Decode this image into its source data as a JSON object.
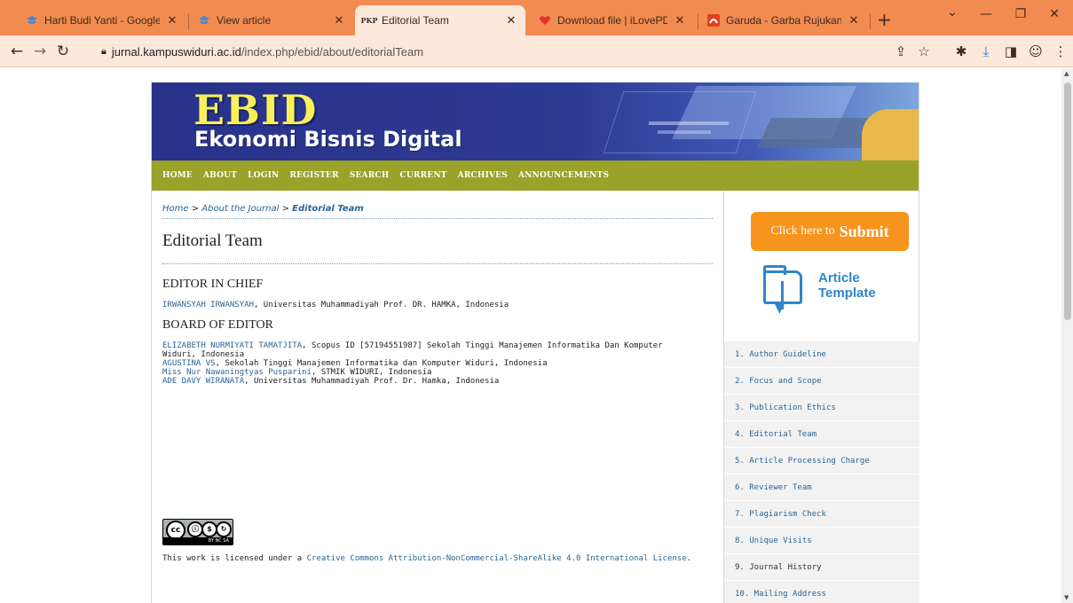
{
  "browser": {
    "tabs": [
      {
        "title": "Harti Budi Yanti - Google Sc",
        "favicon": "graduation-cap-icon"
      },
      {
        "title": "View article",
        "favicon": "graduation-cap-icon"
      },
      {
        "title": "Editorial Team",
        "favicon_text": "PKP",
        "active": true
      },
      {
        "title": "Download file | iLovePDF",
        "favicon": "heart-icon"
      },
      {
        "title": "Garuda - Garba Rujukan Dig",
        "favicon": "garuda-icon"
      }
    ],
    "url_host": "jurnal.kampuswiduri.ac.id",
    "url_path": "/index.php/ebid/about/editorialTeam"
  },
  "site": {
    "logo_main": "EBID",
    "logo_sub": "Ekonomi Bisnis Digital",
    "nav": [
      "HOME",
      "ABOUT",
      "LOGIN",
      "REGISTER",
      "SEARCH",
      "CURRENT",
      "ARCHIVES",
      "ANNOUNCEMENTS"
    ]
  },
  "breadcrumb": {
    "home": "Home",
    "sep": ">",
    "about": "About the Journal",
    "current": "Editorial Team"
  },
  "page_title": "Editorial Team",
  "sections": {
    "chief_heading": "EDITOR IN CHIEF",
    "chief": {
      "name": "IRWANSYAH IRWANSYAH",
      "affil": ", Universitas Muhammadiyah Prof. DR. HAMKA, Indonesia"
    },
    "board_heading": "BOARD OF EDITOR",
    "board": [
      {
        "name": "ELIZABETH NURMIYATI TAMATJITA",
        "affil": ", Scopus ID [57194551987] Sekolah Tinggi Manajemen Informatika Dan Komputer"
      },
      {
        "name": "",
        "affil": "Widuri, Indonesia"
      },
      {
        "name": "AGUSTINA VS",
        "affil": ", Sekolah Tinggi Manajemen Informatika dan Komputer Widuri, Indonesia"
      },
      {
        "name": "Miss Nur Nawaningtyas Pusparini",
        "affil": ", STMIK WIDURI, Indonesia"
      },
      {
        "name": "ADE DAVY WIRANATA",
        "affil": ", Universitas Muhammadiyah Prof. Dr. Hamka, Indonesia"
      }
    ]
  },
  "license": {
    "badge_text": "BY NC SA",
    "prefix": "This work is licensed under a ",
    "link": "Creative Commons Attribution-NonCommercial-ShareAlike 4.0 International License",
    "suffix": "."
  },
  "sidebar": {
    "submit_prefix": "Click here to",
    "submit_bold": "Submit",
    "template_line1": "Article",
    "template_line2": "Template",
    "menu": [
      {
        "label": "1. Author Guideline",
        "link": true
      },
      {
        "label": "2. Focus and Scope",
        "link": true
      },
      {
        "label": "3. Publication Ethics",
        "link": true
      },
      {
        "label": "4. Editorial Team",
        "link": true
      },
      {
        "label": "5. Article Processing Charge",
        "link": true
      },
      {
        "label": "6. Reviewer Team",
        "link": true
      },
      {
        "label": "7. Plagiarism Check",
        "link": true
      },
      {
        "label": "8. Unique Visits",
        "link": true
      },
      {
        "label": "9. Journal History",
        "link": false
      },
      {
        "label": "10. Mailing Address",
        "link": true
      }
    ]
  },
  "colors": {
    "tabbar": "#f28b50",
    "banner": "#2d3a93",
    "navbar": "#9aa22a",
    "submit": "#f7941d",
    "link": "#2a6496"
  }
}
